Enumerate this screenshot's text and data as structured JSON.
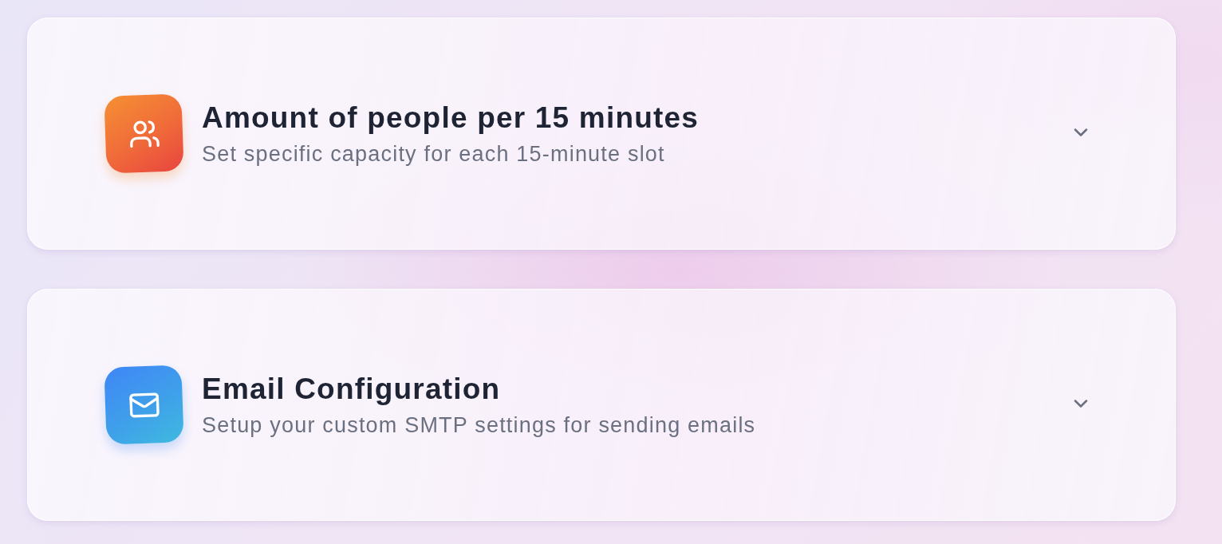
{
  "sections": [
    {
      "kind": "capacity",
      "title": "Amount of people per 15 minutes",
      "description": "Set specific capacity for each 15-minute slot",
      "expanded": false
    },
    {
      "kind": "email",
      "title": "Email Configuration",
      "description": "Setup your custom SMTP settings for sending emails",
      "expanded": false
    }
  ]
}
